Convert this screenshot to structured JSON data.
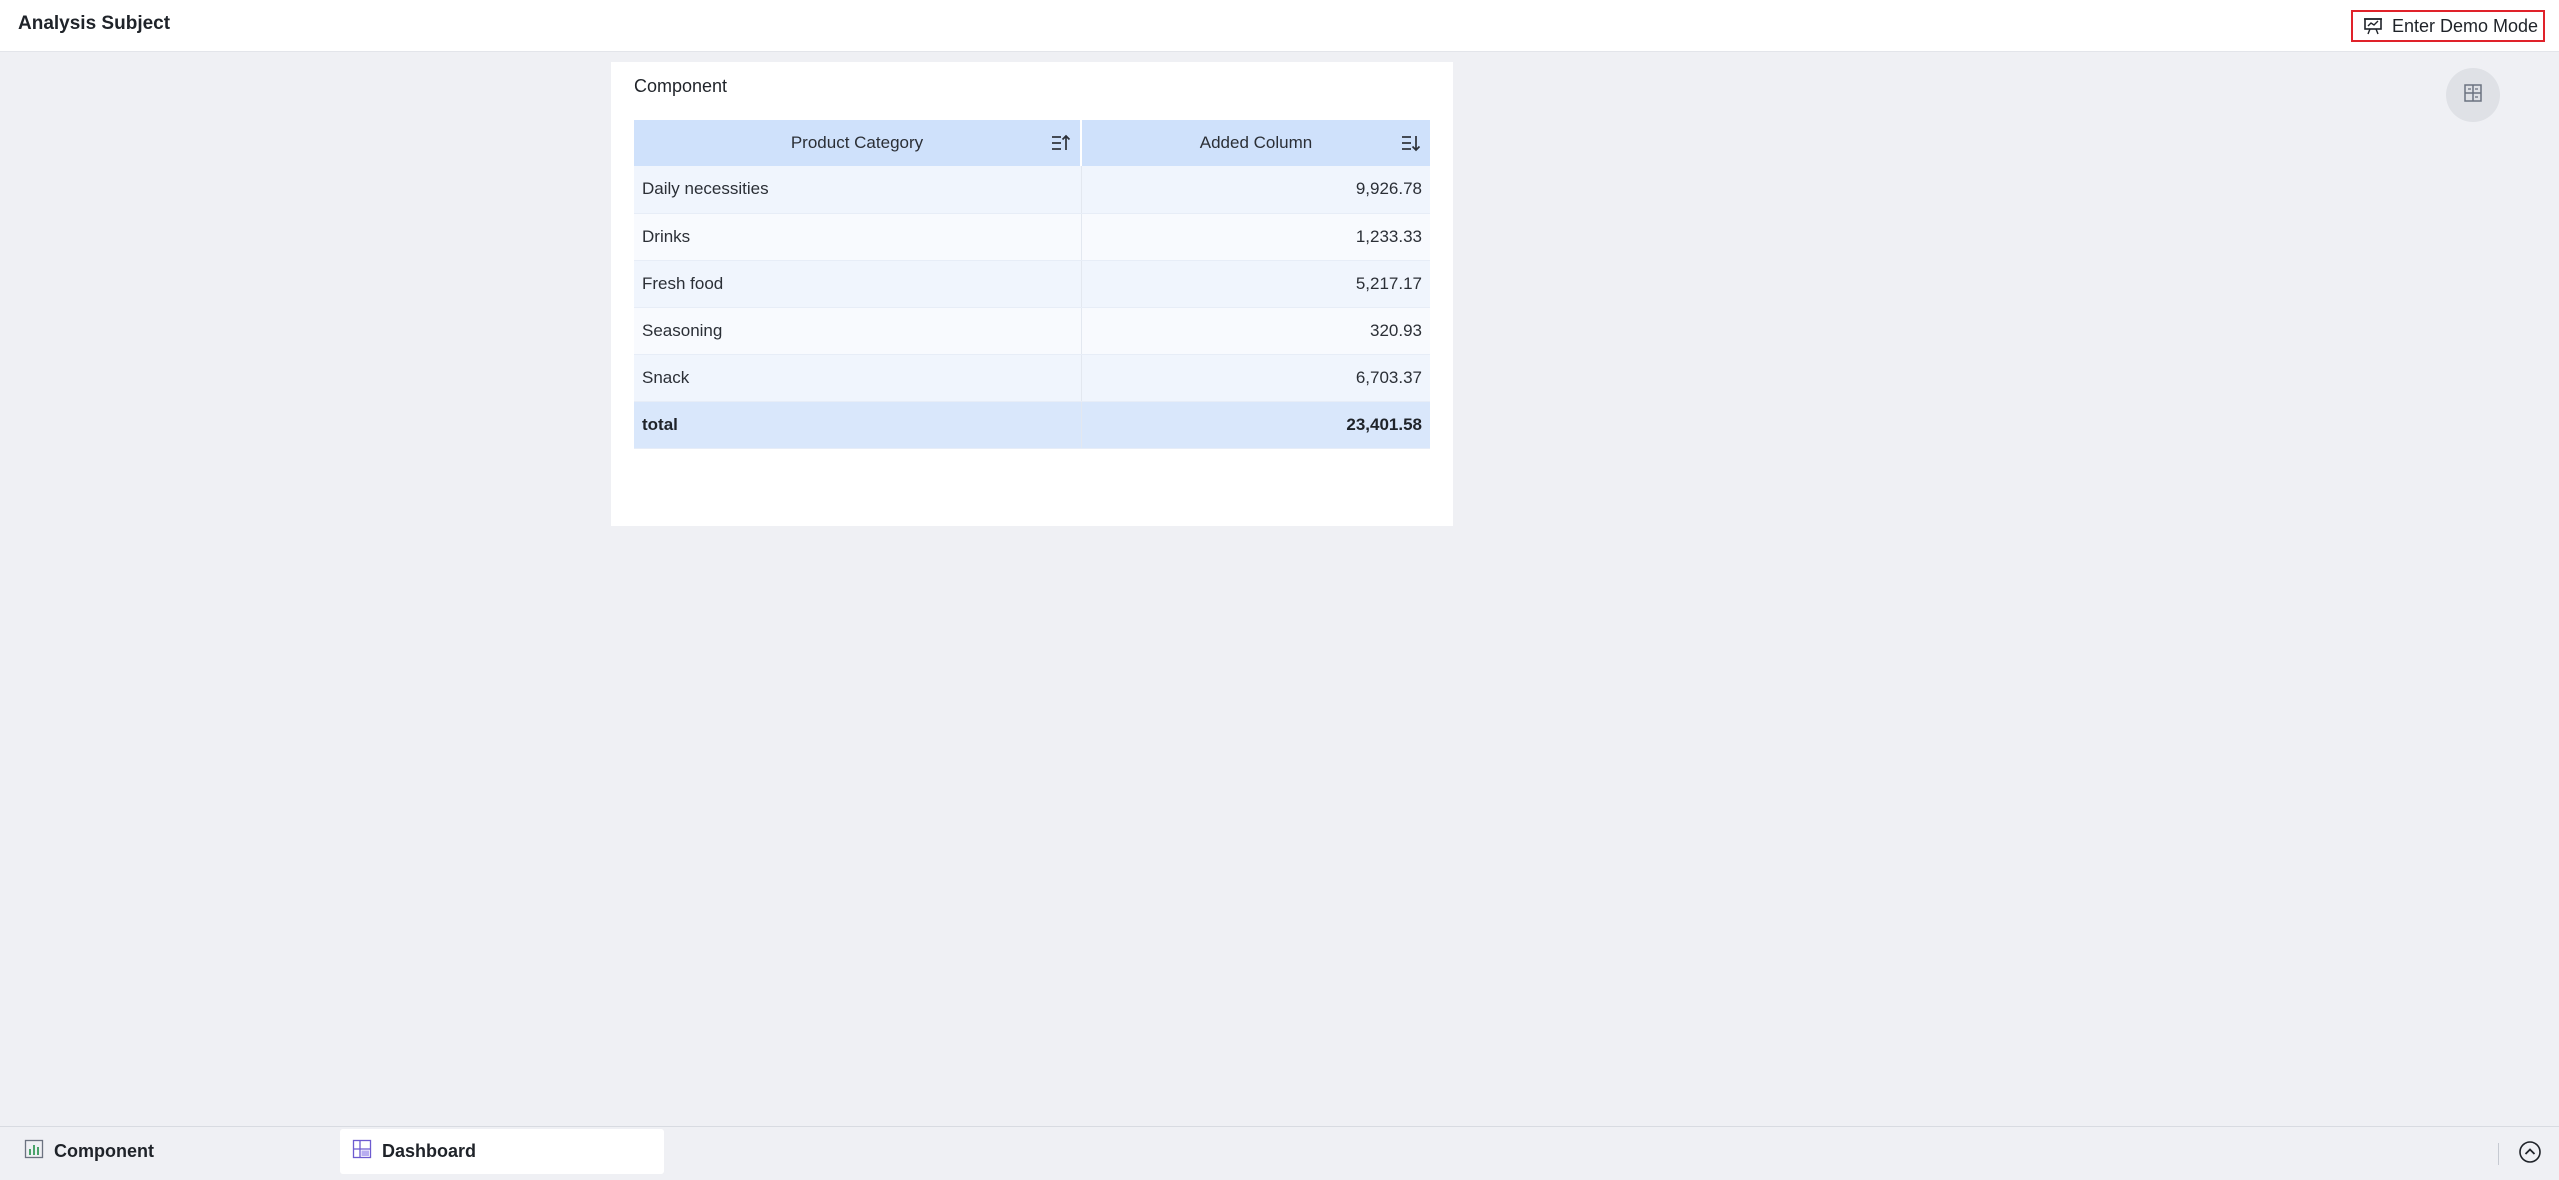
{
  "header": {
    "title": "Analysis Subject",
    "demo_button_label": "Enter Demo Mode"
  },
  "component_card": {
    "title": "Component",
    "columns": [
      "Product Category",
      "Added Column"
    ],
    "rows": [
      [
        "Daily necessities",
        "9,926.78"
      ],
      [
        "Drinks",
        "1,233.33"
      ],
      [
        "Fresh food",
        "5,217.17"
      ],
      [
        "Seasoning",
        "320.93"
      ],
      [
        "Snack",
        "6,703.37"
      ]
    ],
    "total": [
      "total",
      "23,401.58"
    ]
  },
  "bottom_tabs": [
    {
      "label": "Component",
      "icon": "bar-chart-icon"
    },
    {
      "label": "Dashboard",
      "icon": "dashboard-grid-icon",
      "active": true
    }
  ],
  "colors": {
    "accent_blue": "#cfe1fb",
    "highlight_border": "#e0222a"
  }
}
